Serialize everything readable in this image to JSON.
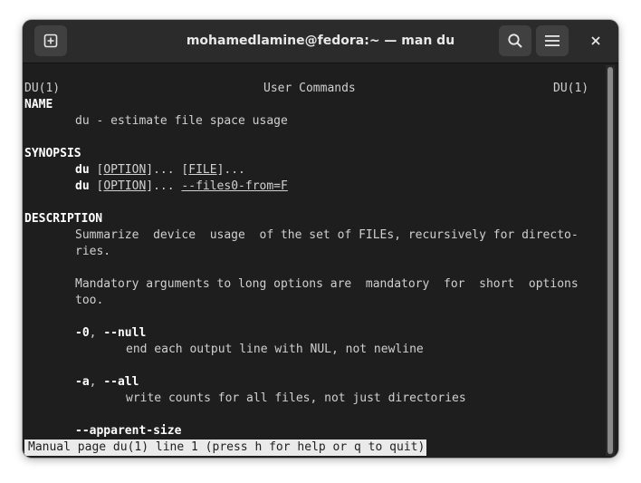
{
  "window": {
    "title": "mohamedlamine@fedora:~ — man du"
  },
  "header": {
    "new_tab_icon": "new-tab-icon",
    "search_icon": "search-icon",
    "menu_icon": "hamburger-menu-icon",
    "close_label": "✕"
  },
  "manpage": {
    "header_left": "DU(1)",
    "header_center": "User Commands",
    "header_right": "DU(1)",
    "name_heading": "NAME",
    "name_text": "du - estimate file space usage",
    "synopsis_heading": "SYNOPSIS",
    "syn1_cmd": "du",
    "syn1_opt": "OPTION",
    "syn1_dots1": "...",
    "syn1_file": "FILE",
    "syn1_dots2": "...",
    "syn2_cmd": "du",
    "syn2_opt": "OPTION",
    "syn2_dots": "...",
    "syn2_files0": "--files0-from=F",
    "description_heading": "DESCRIPTION",
    "desc_line1": "Summarize  device  usage  of the set of FILEs, recursively for directo-",
    "desc_line2": "ries.",
    "desc_line3": "Mandatory arguments to long options are  mandatory  for  short  options",
    "desc_line4": "too.",
    "opt_null_short": "-0",
    "opt_null_long": "--null",
    "opt_null_desc": "end each output line with NUL, not newline",
    "opt_all_short": "-a",
    "opt_all_long": "--all",
    "opt_all_desc": "write counts for all files, not just directories",
    "opt_apparent": "--apparent-size"
  },
  "status_bar": {
    "text": "Manual page du(1) line 1 (press h for help or q to quit)"
  },
  "colors": {
    "terminal_bg": "#1e1e1e",
    "headerbar_bg": "#2b2b2b",
    "button_bg": "#404040",
    "text": "#d0d0d0",
    "bold_text": "#ffffff",
    "status_bg": "#eaeaea"
  }
}
